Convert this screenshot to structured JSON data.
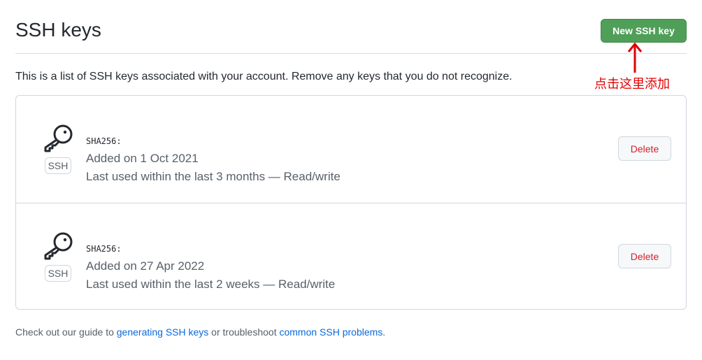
{
  "header": {
    "title": "SSH keys",
    "new_button": "New SSH key"
  },
  "description": "This is a list of SSH keys associated with your account. Remove any keys that you do not recognize.",
  "annotation": "点击这里添加",
  "colors": {
    "primary": "#4f9f58",
    "danger": "#cf222e",
    "annotation": "#e00000"
  },
  "keys": [
    {
      "badge": "SSH",
      "fingerprint": "SHA256:",
      "added": "Added on 1 Oct 2021",
      "last_used": "Last used within the last 3 months — Read/write",
      "delete": "Delete"
    },
    {
      "badge": "SSH",
      "fingerprint": "SHA256:",
      "added": "Added on 27 Apr 2022",
      "last_used": "Last used within the last 2 weeks — Read/write",
      "delete": "Delete"
    }
  ],
  "footer": {
    "prefix": "Check out our guide to ",
    "link1": "generating SSH keys",
    "middle": " or troubleshoot ",
    "link2": "common SSH problems",
    "suffix": "."
  }
}
